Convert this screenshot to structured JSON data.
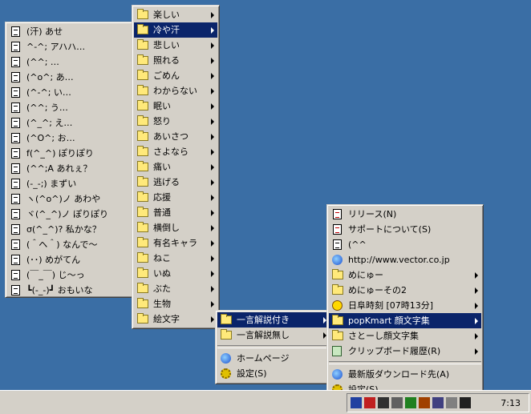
{
  "menu_categories": {
    "items": [
      {
        "label": "楽しい",
        "highlighted": false
      },
      {
        "label": "冷や汗",
        "highlighted": true
      },
      {
        "label": "悲しい",
        "highlighted": false
      },
      {
        "label": "照れる",
        "highlighted": false
      },
      {
        "label": "ごめん",
        "highlighted": false
      },
      {
        "label": "わからない",
        "highlighted": false
      },
      {
        "label": "眠い",
        "highlighted": false
      },
      {
        "label": "怒り",
        "highlighted": false
      },
      {
        "label": "あいさつ",
        "highlighted": false
      },
      {
        "label": "さよなら",
        "highlighted": false
      },
      {
        "label": "痛い",
        "highlighted": false
      },
      {
        "label": "逃げる",
        "highlighted": false
      },
      {
        "label": "応援",
        "highlighted": false
      },
      {
        "label": "普通",
        "highlighted": false
      },
      {
        "label": "横倒し",
        "highlighted": false
      },
      {
        "label": "有名キャラ",
        "highlighted": false
      },
      {
        "label": "ねこ",
        "highlighted": false
      },
      {
        "label": "いぬ",
        "highlighted": false
      },
      {
        "label": "ぶた",
        "highlighted": false
      },
      {
        "label": "生物",
        "highlighted": false
      },
      {
        "label": "絵文字",
        "highlighted": false
      }
    ]
  },
  "menu_faces": {
    "items": [
      "(汗) あせ",
      "^-^; アハハ…",
      "(^^; …",
      "(^o^; あ…",
      "(^-^; い…",
      "(^^; う…",
      "(^_^; え…",
      "(^O^; お…",
      "f(^_^) ぽりぽり",
      "(^^;A あれぇ？",
      "(-_-;) まずい",
      "ヽ(^o^)ノ あわや",
      "ヾ(^_^)ノ ぽりぽり",
      "σ(^_^)? 私かな？",
      "(＾ヘ＾) なんで～",
      "(･･) めがてん",
      "(￣_￣) じ～っ",
      "┗(-_-)┛ おもいな"
    ]
  },
  "menu_main": {
    "items": [
      {
        "type": "item",
        "icon": "document-red-icon",
        "label": "リリース(N)",
        "arrow": false,
        "highlighted": false
      },
      {
        "type": "item",
        "icon": "document-red-icon",
        "label": "サポートについて(S)",
        "arrow": false,
        "highlighted": false
      },
      {
        "type": "item",
        "icon": "document-icon",
        "label": "(^^",
        "arrow": false,
        "highlighted": false
      },
      {
        "type": "item",
        "icon": "globe-icon",
        "label": "http://www.vector.co.jp",
        "arrow": false,
        "highlighted": false
      },
      {
        "type": "item",
        "icon": "folder-icon",
        "label": "めにゅー",
        "arrow": true,
        "highlighted": false
      },
      {
        "type": "item",
        "icon": "folder-icon",
        "label": "めにゅーその2",
        "arrow": true,
        "highlighted": false
      },
      {
        "type": "item",
        "icon": "clock-icon",
        "label": "日阜時刻 [07時13分]",
        "arrow": true,
        "highlighted": false
      },
      {
        "type": "item",
        "icon": "folder-icon",
        "label": "popKmart 顔文字集",
        "arrow": true,
        "highlighted": true
      },
      {
        "type": "item",
        "icon": "folder-icon",
        "label": "さとーし顔文字集",
        "arrow": true,
        "highlighted": false
      },
      {
        "type": "item",
        "icon": "clipboard-icon",
        "label": "クリップボード履歴(R)",
        "arrow": true,
        "highlighted": false
      },
      {
        "type": "separator"
      },
      {
        "type": "item",
        "icon": "globe-icon",
        "label": "最新版ダウンロード先(A)",
        "arrow": false,
        "highlighted": false
      },
      {
        "type": "item",
        "icon": "gear-icon",
        "label": "設定(S)",
        "arrow": false,
        "highlighted": false
      }
    ]
  },
  "menu_sub": {
    "items": [
      {
        "type": "item",
        "icon": "folder-icon",
        "label": "一言解説付き",
        "arrow": true,
        "highlighted": true
      },
      {
        "type": "item",
        "icon": "folder-icon",
        "label": "一言解説無し",
        "arrow": true,
        "highlighted": false
      },
      {
        "type": "separator"
      },
      {
        "type": "item",
        "icon": "globe-icon",
        "label": "ホームページ",
        "arrow": false,
        "highlighted": false
      },
      {
        "type": "item",
        "icon": "gear-icon",
        "label": "設定(S)",
        "arrow": false,
        "highlighted": false
      }
    ]
  },
  "taskbar": {
    "clock": "7:13",
    "tray_icons": [
      "network-icon",
      "pen-icon",
      "speaker-icon",
      "wrench-icon",
      "media-icon",
      "film-icon",
      "monitor-icon",
      "keyboard-icon",
      "printer-icon"
    ]
  },
  "colors": {
    "desktop": "#3a6ea5",
    "menu": "#d4d0c8",
    "highlight": "#0a246a"
  }
}
